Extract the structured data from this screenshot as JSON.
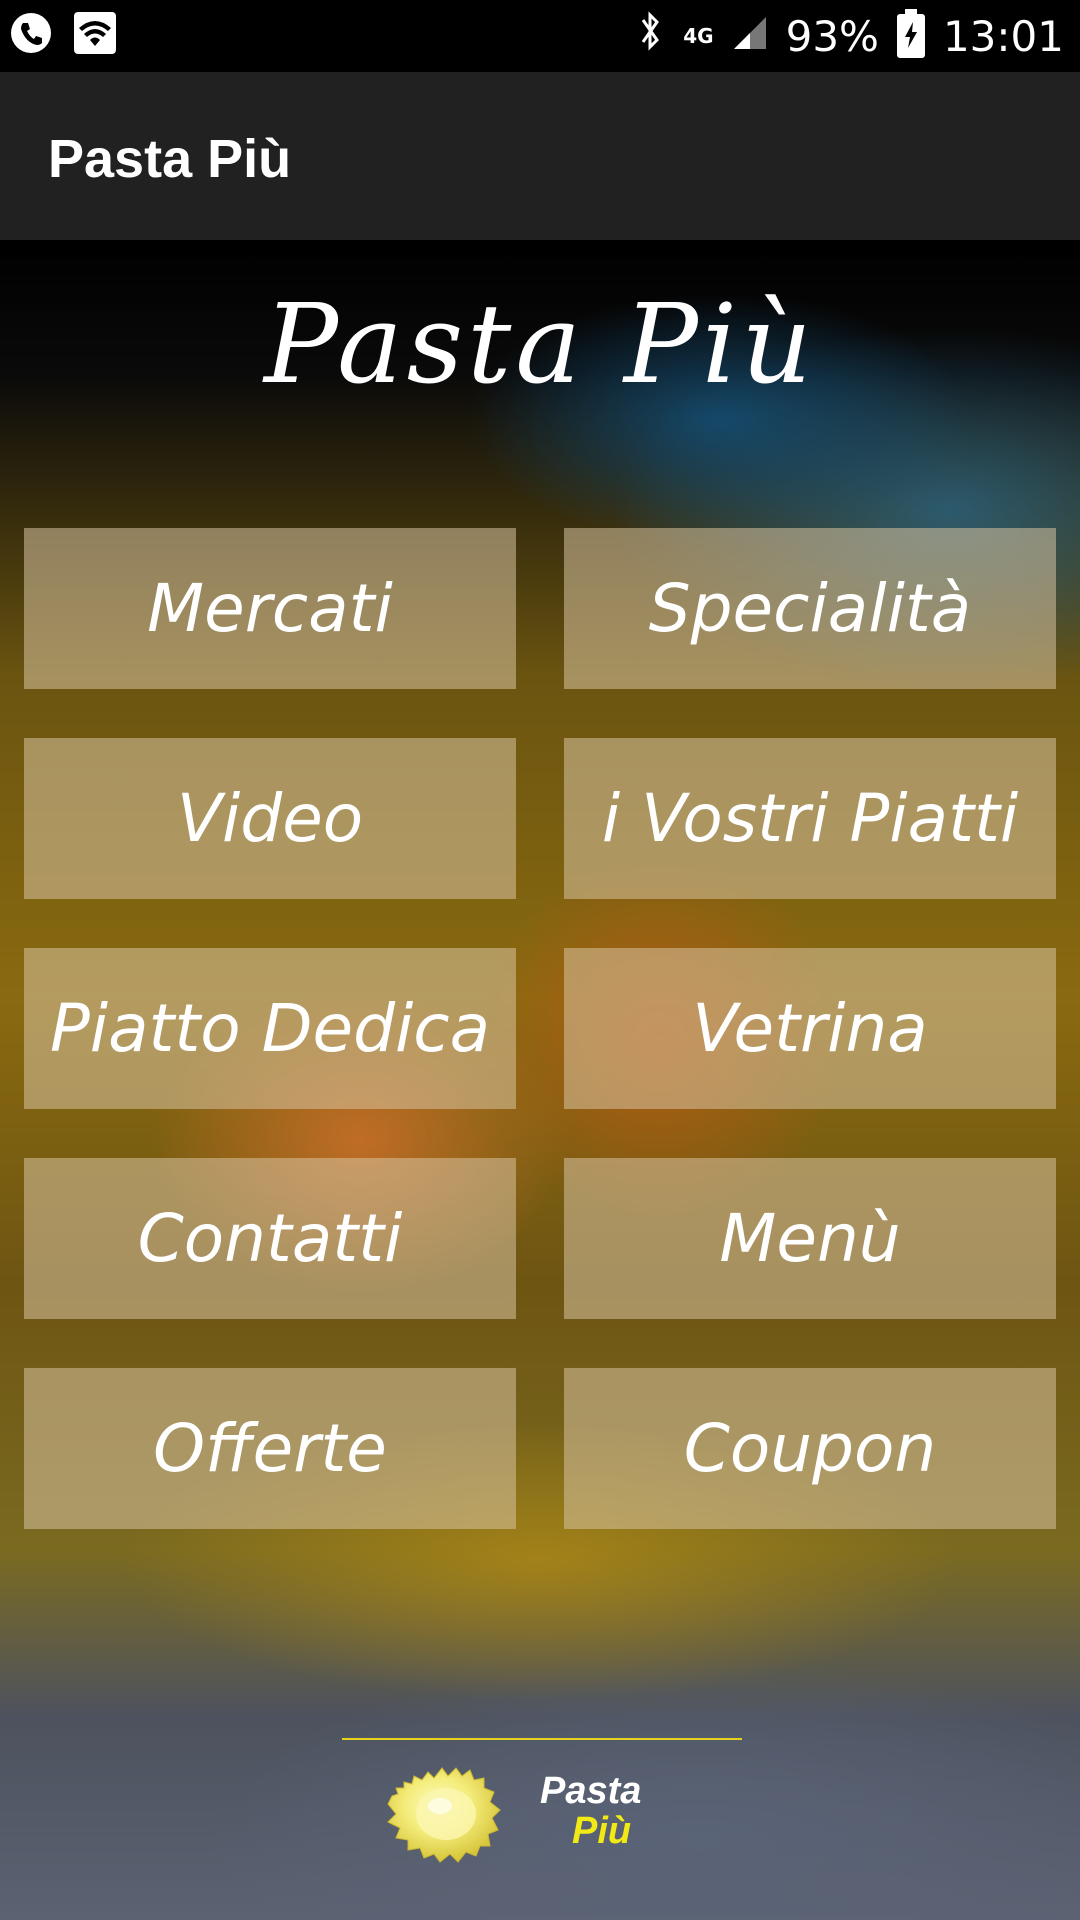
{
  "status_bar": {
    "network": "4G",
    "battery": "93%",
    "time": "13:01",
    "icons": [
      "phone-icon",
      "wifi-icon",
      "bluetooth-icon",
      "signal-icon",
      "battery-icon"
    ]
  },
  "app_bar": {
    "title": "Pasta Più"
  },
  "header": {
    "script_title": "Pasta Più"
  },
  "menu": {
    "items": [
      {
        "label": "Mercati"
      },
      {
        "label": "Specialità"
      },
      {
        "label": "Video"
      },
      {
        "label": "i Vostri Piatti"
      },
      {
        "label": "Piatto Dedica"
      },
      {
        "label": "Vetrina"
      },
      {
        "label": "Contatti"
      },
      {
        "label": "Menù"
      },
      {
        "label": "Offerte"
      },
      {
        "label": "Coupon"
      }
    ]
  },
  "footer": {
    "logo_line1": "Pasta",
    "logo_line2": "Più",
    "colors": {
      "accent": "#f2ea14",
      "line": "#e6d21a"
    }
  }
}
